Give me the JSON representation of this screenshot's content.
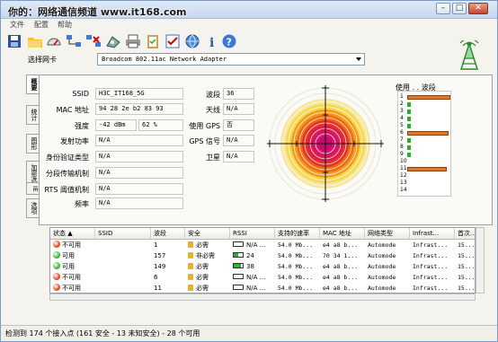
{
  "window": {
    "title": "你的：网络通信频道 www.it168.com",
    "menu": [
      "文件",
      "配置",
      "帮助"
    ]
  },
  "toolbar": {
    "icons": [
      "save-icon",
      "open-folder-icon",
      "gauge-icon",
      "network-icon",
      "disconnect-icon",
      "connect-icon",
      "print-icon",
      "clipboard-icon",
      "checklist-icon",
      "globe-icon",
      "info-icon",
      "help-icon"
    ]
  },
  "adapter": {
    "label": "选择网卡",
    "value": "Broadcom 802.11ac Network Adapter"
  },
  "tabs": [
    "概要",
    "统计",
    "图形",
    "加密选",
    "IE",
    "选项"
  ],
  "details": {
    "ssid_label": "SSID",
    "ssid": "H3C_IT168_5G",
    "mac_label": "MAC 地址",
    "mac": "94 28 2e b2 83 93",
    "strength_label": "强度",
    "strength_dbm": "-42 dBm",
    "strength_pct": "62 %",
    "tx_label": "发射功率",
    "tx": "N/A",
    "auth_label": "身份验证类型",
    "auth": "N/A",
    "frag_label": "分段传输机制",
    "frag": "N/A",
    "rts_label": "RTS 阈值机制",
    "rts": "N/A",
    "freq_label": "频率",
    "freq": "N/A",
    "channel_label": "波段",
    "channel": "36",
    "antenna_label": "天线",
    "antenna": "N/A",
    "gps_label": "使用 GPS",
    "gps": "否",
    "gps_signal_label": "GPS 信号",
    "gps_signal": "N/A",
    "satellite_label": "卫星",
    "satellite": "N/A"
  },
  "channel_panel": {
    "title": "使用 . . 波段",
    "channels": [
      "1",
      "2",
      "3",
      "4",
      "5",
      "6",
      "7",
      "8",
      "9",
      "10",
      "11",
      "12",
      "13",
      "14"
    ]
  },
  "table": {
    "columns": [
      "状态",
      "SSID",
      "波段",
      "安全",
      "RSSI",
      "支持的速率",
      "MAC 地址",
      "网络类型",
      "Infrast...",
      "首次..."
    ],
    "rows": [
      {
        "status": "不可用",
        "status_color": "#e0501e",
        "ssid": "",
        "channel": "1",
        "security": "必需",
        "rssi": "N/A ...",
        "rate": "54.0 Mb...",
        "mac": "e4 a8 b...",
        "type": "Automode",
        "infra": "Infrast...",
        "first": "15..."
      },
      {
        "status": "可用",
        "status_color": "#3cb83c",
        "ssid": "",
        "channel": "157",
        "security": "非必需",
        "rssi": "24",
        "rate": "54.0 Mb...",
        "mac": "70 34 1...",
        "type": "Automode",
        "infra": "Infrast...",
        "first": "15..."
      },
      {
        "status": "可用",
        "status_color": "#3cb83c",
        "ssid": "",
        "channel": "149",
        "security": "必需",
        "rssi": "38",
        "rate": "54.0 Mb...",
        "mac": "e4 a8 b...",
        "type": "Automode",
        "infra": "Infrast...",
        "first": "15..."
      },
      {
        "status": "不可用",
        "status_color": "#e0501e",
        "ssid": "",
        "channel": "6",
        "security": "必需",
        "rssi": "N/A ...",
        "rate": "54.0 Mb...",
        "mac": "e4 a8 b...",
        "type": "Automode",
        "infra": "Infrast...",
        "first": "15..."
      },
      {
        "status": "不可用",
        "status_color": "#e0501e",
        "ssid": "",
        "channel": "11",
        "security": "必需",
        "rssi": "N/A ...",
        "rate": "54.0 Mb...",
        "mac": "e4 a8 b...",
        "type": "Automode",
        "infra": "Infrast...",
        "first": "15..."
      }
    ]
  },
  "status_bar": {
    "text": "检测到 174 个接入点 (161 安全 - 13 未知安全) - 28 个可用"
  },
  "colors": {
    "channel_bar": "#e07a2a",
    "channel_small": "#2fa82f",
    "radar_outer": "#f7e59a",
    "radar_core": "#d4146e"
  }
}
